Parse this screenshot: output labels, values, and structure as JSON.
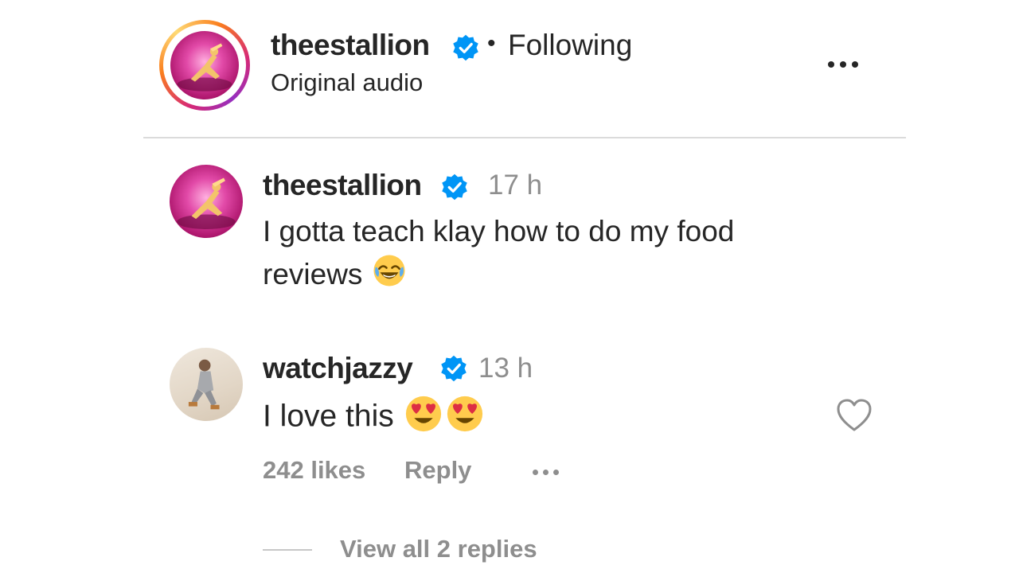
{
  "header": {
    "username": "theestallion",
    "separator": "•",
    "follow_status": "Following",
    "audio_label": "Original audio"
  },
  "comments": [
    {
      "username": "theestallion",
      "time": "17 h",
      "text": "I gotta teach klay how to do my food reviews",
      "emoji": [
        "face-with-tears-of-joy"
      ]
    },
    {
      "username": "watchjazzy",
      "time": "13 h",
      "text": "I love this",
      "emoji": [
        "smiling-face-with-heart-eyes",
        "smiling-face-with-heart-eyes"
      ],
      "likes": "242 likes",
      "reply_label": "Reply",
      "view_replies_label": "View all 2 replies"
    }
  ],
  "colors": {
    "verified_blue": "#0095f6",
    "text_primary": "#262626",
    "text_secondary": "#8e8e8e",
    "divider": "#dbdbdb"
  },
  "icons": [
    "verified-badge-icon",
    "more-options-icon",
    "heart-icon"
  ]
}
